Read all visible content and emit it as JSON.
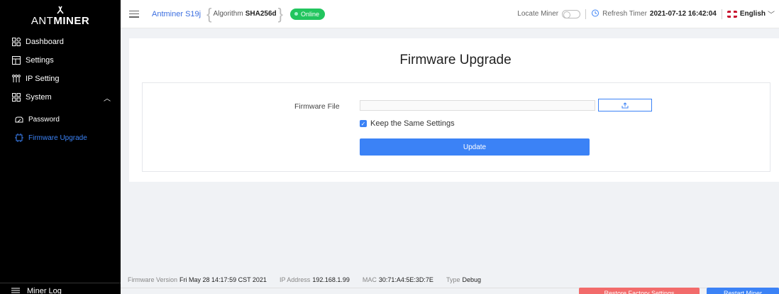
{
  "brand": {
    "prefix": "ANT",
    "suffix": "MINER"
  },
  "sidebar": {
    "items": [
      {
        "label": "Dashboard",
        "icon": "dashboard-icon"
      },
      {
        "label": "Settings",
        "icon": "settings-icon"
      },
      {
        "label": "IP Setting",
        "icon": "network-icon"
      },
      {
        "label": "System",
        "icon": "system-icon",
        "expanded": true
      }
    ],
    "subitems": [
      {
        "label": "Password",
        "icon": "lock-icon"
      },
      {
        "label": "Firmware Upgrade",
        "icon": "chip-icon",
        "active": true
      }
    ],
    "bottom": {
      "label": "Miner Log",
      "icon": "log-icon"
    }
  },
  "header": {
    "model": "Antminer S19j",
    "algorithm_label": "Algorithm",
    "algorithm_value": "SHA256d",
    "status": "Online",
    "locate_label": "Locate Miner",
    "locate_on": false,
    "refresh_label": "Refresh Timer",
    "refresh_time": "2021-07-12 16:42:04",
    "language": "English"
  },
  "main": {
    "title": "Firmware Upgrade",
    "file_label": "Firmware File",
    "file_value": "",
    "keep_settings_label": "Keep the Same Settings",
    "keep_settings_checked": true,
    "update_label": "Update"
  },
  "footer": {
    "fw_label": "Firmware Version",
    "fw_value": "Fri May 28 14:17:59 CST 2021",
    "ip_label": "IP Address",
    "ip_value": "192.168.1.99",
    "mac_label": "MAC",
    "mac_value": "30:71:A4:5E:3D:7E",
    "type_label": "Type",
    "type_value": "Debug",
    "restore_label": "Restore Factory Settings",
    "restart_label": "Restart Miner"
  },
  "colors": {
    "accent": "#3b82f6",
    "online": "#22c55e",
    "danger": "#f26b6b",
    "sidebar_bg": "#000000"
  }
}
